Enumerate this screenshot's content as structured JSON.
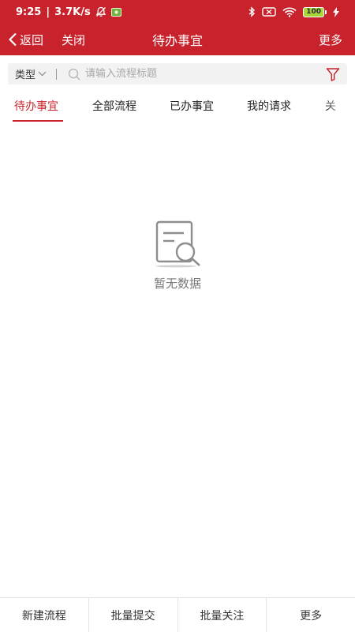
{
  "status_bar": {
    "time": "9:25",
    "network_speed": "3.7K/s",
    "battery_level": "100"
  },
  "nav": {
    "back_label": "返回",
    "close_label": "关闭",
    "title": "待办事宜",
    "more_label": "更多"
  },
  "search": {
    "type_label": "类型",
    "placeholder": "请输入流程标题",
    "value": ""
  },
  "tabs": [
    {
      "label": "待办事宜",
      "active": true
    },
    {
      "label": "全部流程",
      "active": false
    },
    {
      "label": "已办事宜",
      "active": false
    },
    {
      "label": "我的请求",
      "active": false
    },
    {
      "label": "关",
      "active": false
    }
  ],
  "empty_state": {
    "message": "暂无数据"
  },
  "bottom_bar": {
    "new_flow": "新建流程",
    "batch_submit": "批量提交",
    "batch_follow": "批量关注",
    "more": "更多"
  },
  "colors": {
    "brand": "#c8232c",
    "text": "#222222",
    "muted": "#777777"
  },
  "icons": [
    "chevron-left-icon",
    "search-icon",
    "filter-icon",
    "chevron-down-icon",
    "empty-document-search-icon",
    "bluetooth-icon",
    "sim-icon",
    "wifi-icon",
    "battery-icon",
    "charging-icon",
    "notification-muted-icon",
    "app-notification-icon"
  ]
}
